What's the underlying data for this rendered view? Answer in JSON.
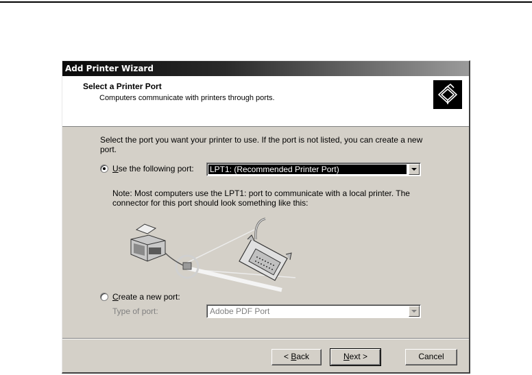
{
  "window": {
    "title": "Add Printer Wizard"
  },
  "header": {
    "title": "Select a Printer Port",
    "subtitle": "Computers communicate with printers through ports.",
    "icon": "printer-port-icon"
  },
  "intro_text": "Select the port you want your printer to use.  If the port is not listed, you can create a new port.",
  "use_existing": {
    "label_accel": "U",
    "label_rest": "se the following port:",
    "selected": true,
    "port_value": "LPT1: (Recommended Printer Port)"
  },
  "note_text": "Note: Most computers use the LPT1: port to communicate with a local printer. The connector for this port should look something like this:",
  "illustration": {
    "subject": "printer-to-parallel-cable-illustration"
  },
  "create_new": {
    "label_accel": "C",
    "label_rest": "reate a new port:",
    "selected": false,
    "type_label": "Type of port:",
    "type_value": "Adobe PDF Port"
  },
  "buttons": {
    "back": {
      "prefix": "< ",
      "accel": "B",
      "rest": "ack"
    },
    "next": {
      "prefix": "",
      "accel": "N",
      "rest": "ext >"
    },
    "cancel": "Cancel"
  }
}
